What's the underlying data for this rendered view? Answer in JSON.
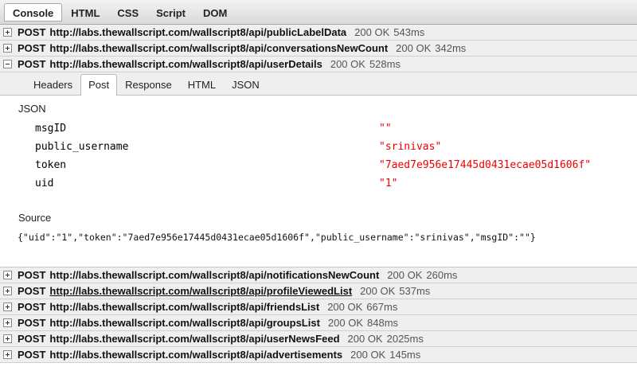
{
  "tabs": [
    "Console",
    "HTML",
    "CSS",
    "Script",
    "DOM"
  ],
  "requests_before": [
    {
      "method": "POST",
      "url": "http://labs.thewallscript.com/wallscript8/api/publicLabelData",
      "status": "200 OK",
      "time": "543ms"
    },
    {
      "method": "POST",
      "url": "http://labs.thewallscript.com/wallscript8/api/conversationsNewCount",
      "status": "200 OK",
      "time": "342ms"
    },
    {
      "method": "POST",
      "url": "http://labs.thewallscript.com/wallscript8/api/userDetails",
      "status": "200 OK",
      "time": "528ms"
    }
  ],
  "detail": {
    "subtabs": [
      "Headers",
      "Post",
      "Response",
      "HTML",
      "JSON"
    ],
    "json_label": "JSON",
    "params": [
      {
        "key": "msgID",
        "value": "\"\""
      },
      {
        "key": "public_username",
        "value": "\"srinivas\""
      },
      {
        "key": "token",
        "value": "\"7aed7e956e17445d0431ecae05d1606f\""
      },
      {
        "key": "uid",
        "value": "\"1\""
      }
    ],
    "source_label": "Source",
    "source_text": "{\"uid\":\"1\",\"token\":\"7aed7e956e17445d0431ecae05d1606f\",\"public_username\":\"srinivas\",\"msgID\":\"\"}"
  },
  "requests_after": [
    {
      "method": "POST",
      "url": "http://labs.thewallscript.com/wallscript8/api/notificationsNewCount",
      "status": "200 OK",
      "time": "260ms"
    },
    {
      "method": "POST",
      "url": "http://labs.thewallscript.com/wallscript8/api/profileViewedList",
      "status": "200 OK",
      "time": "537ms"
    },
    {
      "method": "POST",
      "url": "http://labs.thewallscript.com/wallscript8/api/friendsList",
      "status": "200 OK",
      "time": "667ms"
    },
    {
      "method": "POST",
      "url": "http://labs.thewallscript.com/wallscript8/api/groupsList",
      "status": "200 OK",
      "time": "848ms"
    },
    {
      "method": "POST",
      "url": "http://labs.thewallscript.com/wallscript8/api/userNewsFeed",
      "status": "200 OK",
      "time": "2025ms"
    },
    {
      "method": "POST",
      "url": "http://labs.thewallscript.com/wallscript8/api/advertisements",
      "status": "200 OK",
      "time": "145ms"
    }
  ]
}
